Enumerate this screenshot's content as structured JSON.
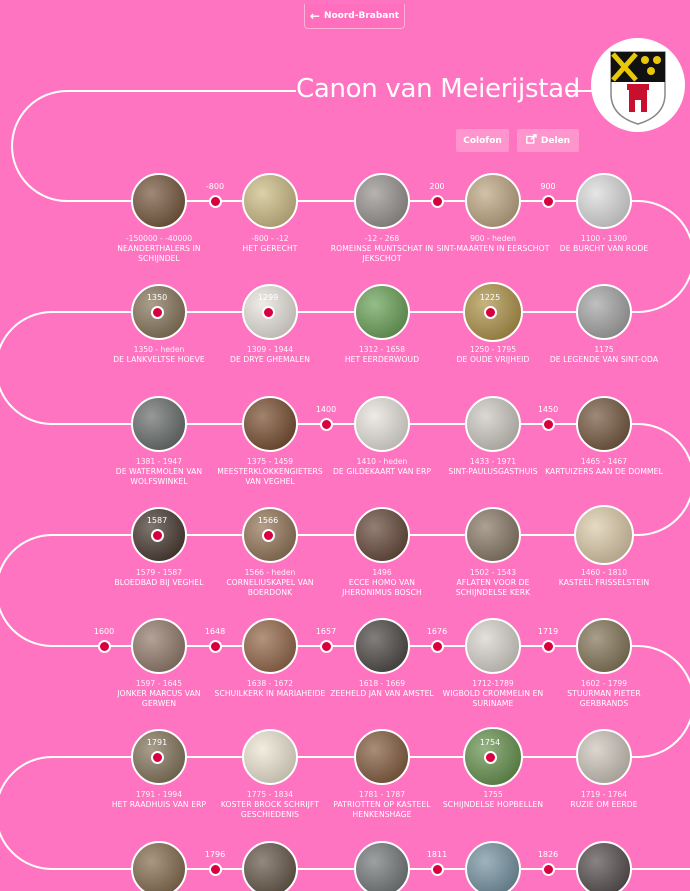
{
  "nav": {
    "back_label": "Noord-Brabant",
    "back_icon": "arrow-left-icon"
  },
  "header": {
    "title": "Canon van Meierijstad",
    "crest_icon": "coat-of-arms-icon"
  },
  "actions": {
    "colofon_label": "Colofon",
    "share_label": "Delen",
    "share_icon": "share-icon"
  },
  "colors": {
    "background": "#ff74c1",
    "dot": "#d8003f",
    "line": "#ffffff"
  },
  "rows": [
    {
      "markers": [
        "-800",
        "200",
        "900"
      ],
      "items": [
        {
          "date": "-150000 - -40000",
          "title": "Neanderthalers in Schijndel",
          "color": "#6b4a2e"
        },
        {
          "date": "-800 - -12",
          "title": "Het gerecht",
          "color": "#c9b77c"
        },
        {
          "date": "-12 - 268",
          "title": "Romeinse muntschat in Jekschot",
          "color": "#8e8a86"
        },
        {
          "date": "900 - heden",
          "title": "Sint-Maarten in Eerschot",
          "color": "#b9a07a"
        },
        {
          "date": "1100 - 1300",
          "title": "De burcht van Rode",
          "color": "#d8d8d8"
        }
      ]
    },
    {
      "markers": [
        "1350",
        "1299",
        "1225"
      ],
      "items": [
        {
          "date": "1350 - heden",
          "title": "De Lankveltse Hoeve",
          "color": "#7d6a4d"
        },
        {
          "date": "1309 - 1944",
          "title": "De drye ghemalen",
          "color": "#e6e2da"
        },
        {
          "date": "1312 - 1658",
          "title": "Het Eerderwoud",
          "color": "#5e9a4a"
        },
        {
          "date": "1250 - 1795",
          "title": "De oude vrijheid",
          "color": "#a88a3a"
        },
        {
          "date": "1175",
          "title": "De legende van Sint-Oda",
          "color": "#9d9d9d"
        }
      ]
    },
    {
      "markers": [
        "1400",
        "1450"
      ],
      "items": [
        {
          "date": "1381 - 1947",
          "title": "De watermolen van Wolfswinkel",
          "color": "#5d6260"
        },
        {
          "date": "1375 - 1459",
          "title": "Meesterklokkengieters van Veghel",
          "color": "#6e4020"
        },
        {
          "date": "1410 - heden",
          "title": "De gildekaart van Erp",
          "color": "#e4e0d8"
        },
        {
          "date": "1433 - 1971",
          "title": "Sint-Paulusgasthuis",
          "color": "#c8c4bc"
        },
        {
          "date": "1465 - 1467",
          "title": "Kartuizers aan de Dommel",
          "color": "#6a4a30"
        }
      ]
    },
    {
      "markers": [
        "1587",
        "1566"
      ],
      "items": [
        {
          "date": "1579 - 1587",
          "title": "Bloedbad bij Veghel",
          "color": "#3a2a20"
        },
        {
          "date": "1566 - heden",
          "title": "Corneliuskapel van Boerdonk",
          "color": "#8a6a4a"
        },
        {
          "date": "1496",
          "title": "Ecce Homo van Jheronimus Bosch",
          "color": "#5a3a2a"
        },
        {
          "date": "1502 - 1543",
          "title": "Aflaten voor de Schijndelse kerk",
          "color": "#7f6e5a"
        },
        {
          "date": "1460 - 1810",
          "title": "Kasteel Frisselstein",
          "color": "#d9c6a2"
        }
      ]
    },
    {
      "markers": [
        "1600",
        "1648",
        "1657",
        "1676",
        "1719"
      ],
      "items": [
        {
          "date": "1597 - 1645",
          "title": "Jonker Marcus van Gerwen",
          "color": "#8a7060"
        },
        {
          "date": "1638 - 1672",
          "title": "Schuilkerk in Mariaheide",
          "color": "#8b5a3a"
        },
        {
          "date": "1618 - 1669",
          "title": "Zeeheld Jan van Amstel",
          "color": "#3e3a36"
        },
        {
          "date": "1712-1789",
          "title": "Wigbold Crommelin en Suriname",
          "color": "#d4d0c8"
        },
        {
          "date": "1602 - 1799",
          "title": "Stuurman Pieter Gerbrands",
          "color": "#7a6a4a"
        }
      ]
    },
    {
      "markers": [
        "1791",
        "1754"
      ],
      "items": [
        {
          "date": "1791 - 1994",
          "title": "Het raadhuis van Erp",
          "color": "#7a6a4e"
        },
        {
          "date": "1775 - 1834",
          "title": "Koster Brock schrijft geschiedenis",
          "color": "#ebe3cf"
        },
        {
          "date": "1781 - 1787",
          "title": "Patriotten op Kasteel Henkenshage",
          "color": "#7a5030"
        },
        {
          "date": "1755",
          "title": "Schijndelse hopbellen",
          "color": "#5a8a40"
        },
        {
          "date": "1719 - 1764",
          "title": "Ruzie om eerde",
          "color": "#c8c0b4"
        }
      ]
    },
    {
      "markers": [
        "1796",
        "1811",
        "1826"
      ],
      "items": [
        {
          "date": "",
          "title": "",
          "color": "#7a6040"
        },
        {
          "date": "",
          "title": "",
          "color": "#5a4a3a"
        },
        {
          "date": "",
          "title": "",
          "color": "#6a6e70"
        },
        {
          "date": "",
          "title": "",
          "color": "#6a8a9a"
        },
        {
          "date": "",
          "title": "",
          "color": "#4a4040"
        }
      ]
    }
  ]
}
